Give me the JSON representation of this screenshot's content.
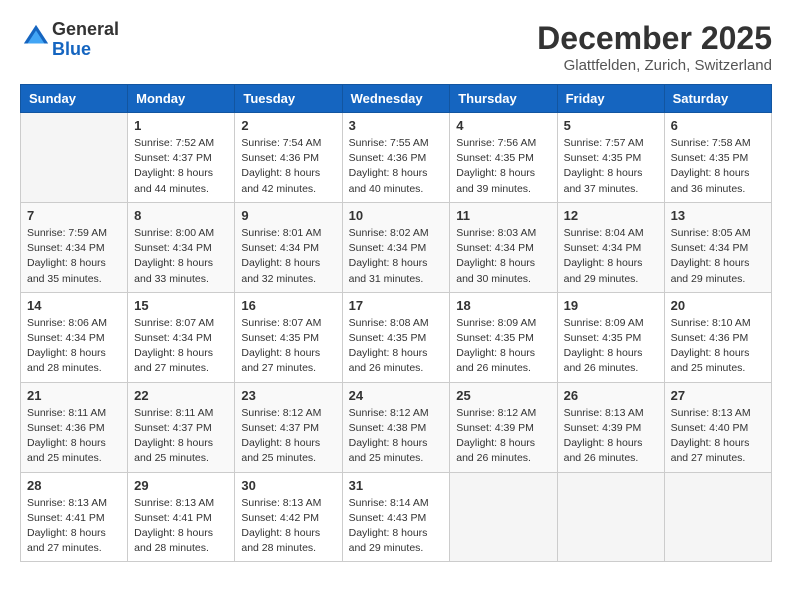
{
  "logo": {
    "general": "General",
    "blue": "Blue"
  },
  "header": {
    "month": "December 2025",
    "location": "Glattfelden, Zurich, Switzerland"
  },
  "weekdays": [
    "Sunday",
    "Monday",
    "Tuesday",
    "Wednesday",
    "Thursday",
    "Friday",
    "Saturday"
  ],
  "weeks": [
    [
      null,
      {
        "day": 1,
        "sunrise": "7:52 AM",
        "sunset": "4:37 PM",
        "daylight": "8 hours and 44 minutes."
      },
      {
        "day": 2,
        "sunrise": "7:54 AM",
        "sunset": "4:36 PM",
        "daylight": "8 hours and 42 minutes."
      },
      {
        "day": 3,
        "sunrise": "7:55 AM",
        "sunset": "4:36 PM",
        "daylight": "8 hours and 40 minutes."
      },
      {
        "day": 4,
        "sunrise": "7:56 AM",
        "sunset": "4:35 PM",
        "daylight": "8 hours and 39 minutes."
      },
      {
        "day": 5,
        "sunrise": "7:57 AM",
        "sunset": "4:35 PM",
        "daylight": "8 hours and 37 minutes."
      },
      {
        "day": 6,
        "sunrise": "7:58 AM",
        "sunset": "4:35 PM",
        "daylight": "8 hours and 36 minutes."
      }
    ],
    [
      {
        "day": 7,
        "sunrise": "7:59 AM",
        "sunset": "4:34 PM",
        "daylight": "8 hours and 35 minutes."
      },
      {
        "day": 8,
        "sunrise": "8:00 AM",
        "sunset": "4:34 PM",
        "daylight": "8 hours and 33 minutes."
      },
      {
        "day": 9,
        "sunrise": "8:01 AM",
        "sunset": "4:34 PM",
        "daylight": "8 hours and 32 minutes."
      },
      {
        "day": 10,
        "sunrise": "8:02 AM",
        "sunset": "4:34 PM",
        "daylight": "8 hours and 31 minutes."
      },
      {
        "day": 11,
        "sunrise": "8:03 AM",
        "sunset": "4:34 PM",
        "daylight": "8 hours and 30 minutes."
      },
      {
        "day": 12,
        "sunrise": "8:04 AM",
        "sunset": "4:34 PM",
        "daylight": "8 hours and 29 minutes."
      },
      {
        "day": 13,
        "sunrise": "8:05 AM",
        "sunset": "4:34 PM",
        "daylight": "8 hours and 29 minutes."
      }
    ],
    [
      {
        "day": 14,
        "sunrise": "8:06 AM",
        "sunset": "4:34 PM",
        "daylight": "8 hours and 28 minutes."
      },
      {
        "day": 15,
        "sunrise": "8:07 AM",
        "sunset": "4:34 PM",
        "daylight": "8 hours and 27 minutes."
      },
      {
        "day": 16,
        "sunrise": "8:07 AM",
        "sunset": "4:35 PM",
        "daylight": "8 hours and 27 minutes."
      },
      {
        "day": 17,
        "sunrise": "8:08 AM",
        "sunset": "4:35 PM",
        "daylight": "8 hours and 26 minutes."
      },
      {
        "day": 18,
        "sunrise": "8:09 AM",
        "sunset": "4:35 PM",
        "daylight": "8 hours and 26 minutes."
      },
      {
        "day": 19,
        "sunrise": "8:09 AM",
        "sunset": "4:35 PM",
        "daylight": "8 hours and 26 minutes."
      },
      {
        "day": 20,
        "sunrise": "8:10 AM",
        "sunset": "4:36 PM",
        "daylight": "8 hours and 25 minutes."
      }
    ],
    [
      {
        "day": 21,
        "sunrise": "8:11 AM",
        "sunset": "4:36 PM",
        "daylight": "8 hours and 25 minutes."
      },
      {
        "day": 22,
        "sunrise": "8:11 AM",
        "sunset": "4:37 PM",
        "daylight": "8 hours and 25 minutes."
      },
      {
        "day": 23,
        "sunrise": "8:12 AM",
        "sunset": "4:37 PM",
        "daylight": "8 hours and 25 minutes."
      },
      {
        "day": 24,
        "sunrise": "8:12 AM",
        "sunset": "4:38 PM",
        "daylight": "8 hours and 25 minutes."
      },
      {
        "day": 25,
        "sunrise": "8:12 AM",
        "sunset": "4:39 PM",
        "daylight": "8 hours and 26 minutes."
      },
      {
        "day": 26,
        "sunrise": "8:13 AM",
        "sunset": "4:39 PM",
        "daylight": "8 hours and 26 minutes."
      },
      {
        "day": 27,
        "sunrise": "8:13 AM",
        "sunset": "4:40 PM",
        "daylight": "8 hours and 27 minutes."
      }
    ],
    [
      {
        "day": 28,
        "sunrise": "8:13 AM",
        "sunset": "4:41 PM",
        "daylight": "8 hours and 27 minutes."
      },
      {
        "day": 29,
        "sunrise": "8:13 AM",
        "sunset": "4:41 PM",
        "daylight": "8 hours and 28 minutes."
      },
      {
        "day": 30,
        "sunrise": "8:13 AM",
        "sunset": "4:42 PM",
        "daylight": "8 hours and 28 minutes."
      },
      {
        "day": 31,
        "sunrise": "8:14 AM",
        "sunset": "4:43 PM",
        "daylight": "8 hours and 29 minutes."
      },
      null,
      null,
      null
    ]
  ],
  "labels": {
    "sunrise": "Sunrise:",
    "sunset": "Sunset:",
    "daylight": "Daylight:"
  }
}
